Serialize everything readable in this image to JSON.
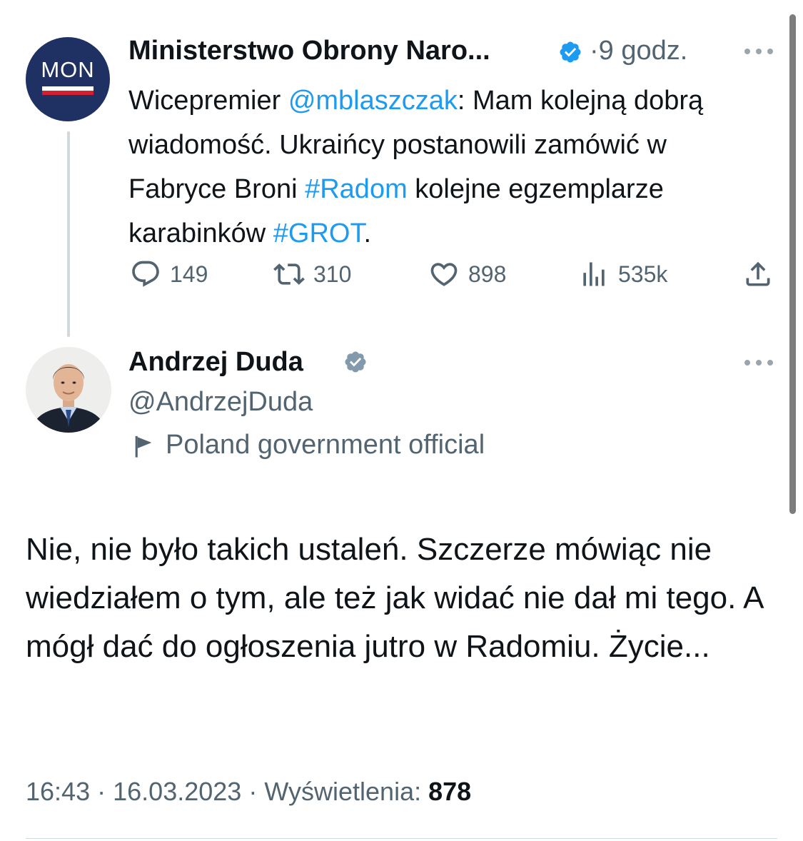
{
  "parent_tweet": {
    "avatar_text": "MON",
    "author_name": "Ministerstwo Obrony Naro...",
    "separator": "·",
    "time": "9 godz.",
    "text_segments": [
      {
        "text": "Wicepremier ",
        "link": false
      },
      {
        "text": "@mblaszczak",
        "link": true
      },
      {
        "text": ": Mam kolejną dobrą wiadomość. Ukraińcy postanowili zamówić w Fabryce Broni ",
        "link": false
      },
      {
        "text": "#Radom",
        "link": true
      },
      {
        "text": " kolejne egzemplarze karabinków ",
        "link": false
      },
      {
        "text": "#GROT",
        "link": true
      },
      {
        "text": ".",
        "link": false
      }
    ],
    "actions": {
      "reply_count": "149",
      "retweet_count": "310",
      "like_count": "898",
      "views_count": "535k"
    }
  },
  "main_tweet": {
    "author_name": "Andrzej Duda",
    "handle": "@AndrzejDuda",
    "affiliation_label": "Poland government official",
    "text": "Nie, nie było takich ustaleń. Szczerze mówiąc nie wiedziałem o tym, ale też jak widać nie dał mi tego. A mógł dać do ogłoszenia jutro w Radomiu. Życie...",
    "time": "16:43",
    "date": "16.03.2023",
    "separator": "·",
    "views_label": "Wyświetlenia:",
    "views_count": "878"
  },
  "icons": {
    "verified_parent": "verified-badge-blue",
    "verified_main": "verified-badge-gray",
    "flag": "flag-icon",
    "more": "more-dots-icon",
    "reply": "reply-icon",
    "retweet": "retweet-icon",
    "like": "heart-icon",
    "views": "views-icon",
    "share": "share-icon"
  },
  "colors": {
    "link": "#1d9bf0",
    "secondary_text": "#536471",
    "mon_navy": "#1f3163",
    "mon_red": "#d2202f",
    "verified_blue": "#1d9bf0",
    "verified_gray": "#829aab"
  }
}
